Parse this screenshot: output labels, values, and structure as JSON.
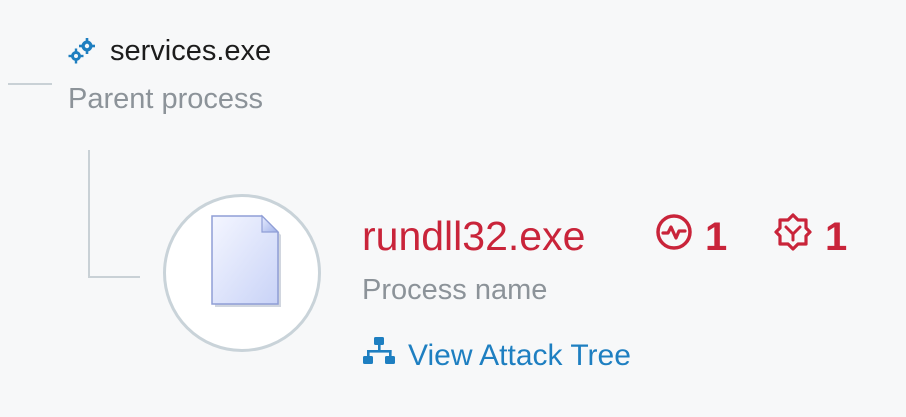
{
  "parent": {
    "name": "services.exe",
    "label": "Parent process",
    "icon": "gears-icon"
  },
  "process": {
    "name": "rundll32.exe",
    "label": "Process name",
    "icon": "document-icon",
    "activity_count": "1",
    "threat_count": "1",
    "activity_icon": "activity-pulse-icon",
    "threat_icon": "threat-hexagon-icon"
  },
  "actions": {
    "view_attack_tree": "View Attack Tree",
    "view_attack_tree_icon": "tree-hierarchy-icon"
  },
  "colors": {
    "alert": "#c9243a",
    "link": "#1e7fc1",
    "muted": "#8c9399",
    "connector": "#c9d1d6",
    "parent_icon": "#1f7fc0"
  }
}
